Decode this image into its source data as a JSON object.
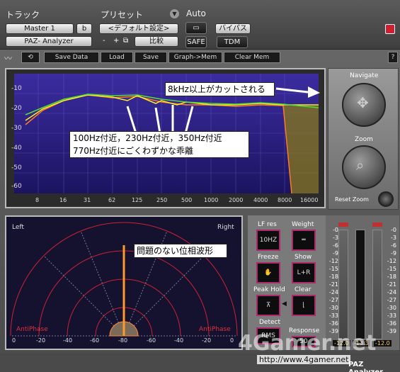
{
  "header": {
    "track_label": "トラック",
    "preset_label": "プリセット",
    "auto_label": "Auto",
    "track_name": "Master 1",
    "track_b": "b",
    "preset_value": "<デフォルト設定>",
    "compare": "比較",
    "plugin_name": "PAZ- Analyzer",
    "bypass": "バイパス",
    "safe": "SAFE",
    "tdm": "TDM",
    "minus": "-",
    "plus": "+"
  },
  "toolbar": {
    "undo": "⟲",
    "save_data": "Save Data",
    "load": "Load",
    "save": "Save",
    "graph_mem": "Graph->Mem",
    "clear_mem": "Clear Mem",
    "help": "?"
  },
  "graph": {
    "y_labels": [
      "-10",
      "-20",
      "-30",
      "-40",
      "-50",
      "-60"
    ],
    "x_labels": [
      "8",
      "16",
      "31",
      "62",
      "125",
      "250",
      "500",
      "1000",
      "2000",
      "4000",
      "8000",
      "16000"
    ],
    "callout_cut": "8kHz以上がカットされる",
    "callout_lines": [
      "100Hz付近，230Hz付近，350Hz付近",
      "770Hz付近にごくわずかな乖離"
    ]
  },
  "nav": {
    "navigate": "Navigate",
    "zoom": "Zoom",
    "reset_zoom": "Reset Zoom"
  },
  "phase": {
    "left": "Left",
    "right": "Right",
    "anti_left": "AntiPhase",
    "anti_right": "AntiPhase",
    "callout": "問題のない位相波形",
    "x_labels": [
      "0",
      "-20",
      "-40",
      "-60",
      "-80",
      "-60",
      "-40",
      "-20",
      "0"
    ]
  },
  "controls": {
    "lf_res": "LF res",
    "lf_val": "10HZ",
    "weight": "Weight",
    "freeze": "Freeze",
    "show": "Show",
    "show_val": "L+R",
    "peak_hold": "Peak Hold",
    "clear": "Clear",
    "detect": "Detect",
    "rms": "RMS",
    "response": "Response",
    "resp_val": "50"
  },
  "meters": {
    "scale": [
      "-0",
      "-3",
      "-6",
      "-9",
      "-12",
      "-15",
      "-18",
      "-21",
      "-24",
      "-27",
      "-30",
      "-33",
      "-36",
      "-39"
    ],
    "readouts": [
      "-12.0",
      "-13.3",
      "-12.0"
    ]
  },
  "footer": {
    "title": "PAZ Analyzer",
    "url": "http://www.4gamer.net",
    "watermark": "4Gamer.net"
  },
  "colors": {
    "accent": "#aa2a6a",
    "plot_bg": "#2a1f8a",
    "green": "#55dd33",
    "yellow": "#ffee22",
    "orange": "#ff7a22"
  }
}
